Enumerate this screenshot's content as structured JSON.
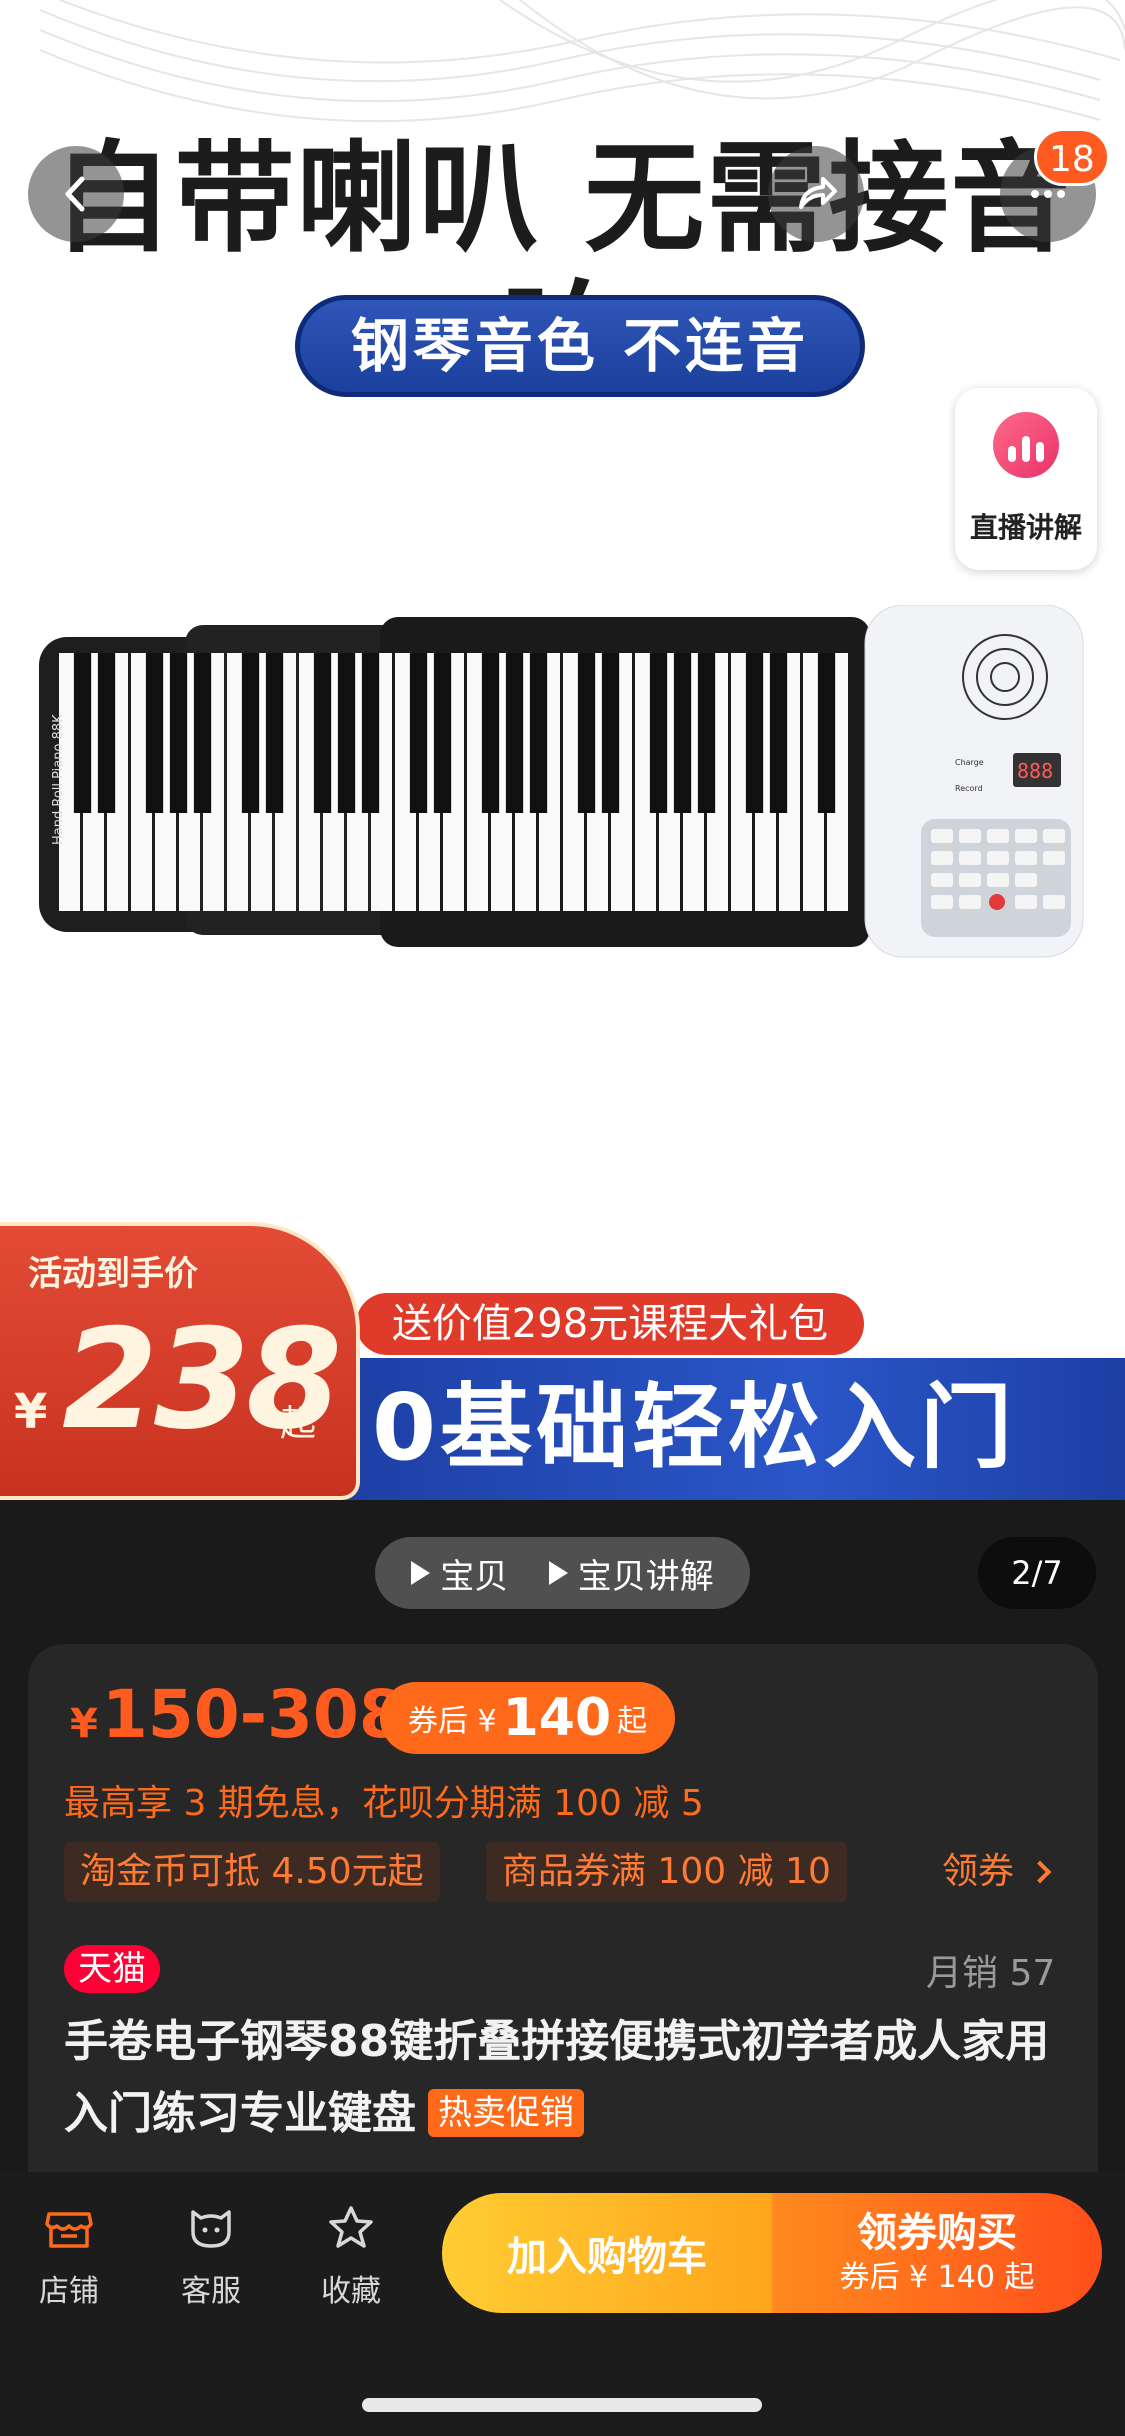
{
  "hero": {
    "headline": "自带喇叭 无需接音响",
    "subbanner": "钢琴音色 不连音",
    "cart_badge": "18",
    "live_label": "直播讲解",
    "gift": "送价值298元课程大礼包",
    "slogan": "0基础轻松入门",
    "activity_label": "活动到手价",
    "activity_currency": "¥",
    "activity_price": "238",
    "activity_suffix": "起",
    "piano_brand_text": "Hand Roll Piano 88K",
    "piano_display": "888",
    "piano_labels": [
      "Charge",
      "Record"
    ]
  },
  "switcher": {
    "items": [
      "宝贝",
      "宝贝讲解"
    ],
    "page_indicator": "2/7"
  },
  "product": {
    "currency": "¥",
    "price_range": "150-308",
    "coupon_prefix": "券后 ¥",
    "coupon_amount": "140",
    "coupon_suffix": "起",
    "installment": "最高享 3 期免息，花呗分期满 100 减 5",
    "chips": [
      "淘金币可抵 4.50元起",
      "商品券满 100 减 10"
    ],
    "get_coupon": "领券",
    "store_tag": "天猫",
    "monthly_sales": "月销 57",
    "title": "手卷电子钢琴88键折叠拼接便携式初学者成人家用入门练习专业键盘",
    "hot_tag": "热卖促销"
  },
  "bottom": {
    "tabs": [
      "店铺",
      "客服",
      "收藏"
    ],
    "add_to_cart": "加入购物车",
    "buy_main": "领券购买",
    "buy_sub": "券后 ¥ 140 起"
  },
  "colors": {
    "accent_orange": "#ff5a1f",
    "tmall_red": "#ff0036",
    "promo_blue": "#1d3fa4"
  },
  "icons": [
    "back-arrow-icon",
    "share-icon",
    "more-icon",
    "live-bars-icon",
    "play-icon",
    "chevron-right-icon",
    "store-icon",
    "service-icon",
    "star-icon"
  ]
}
